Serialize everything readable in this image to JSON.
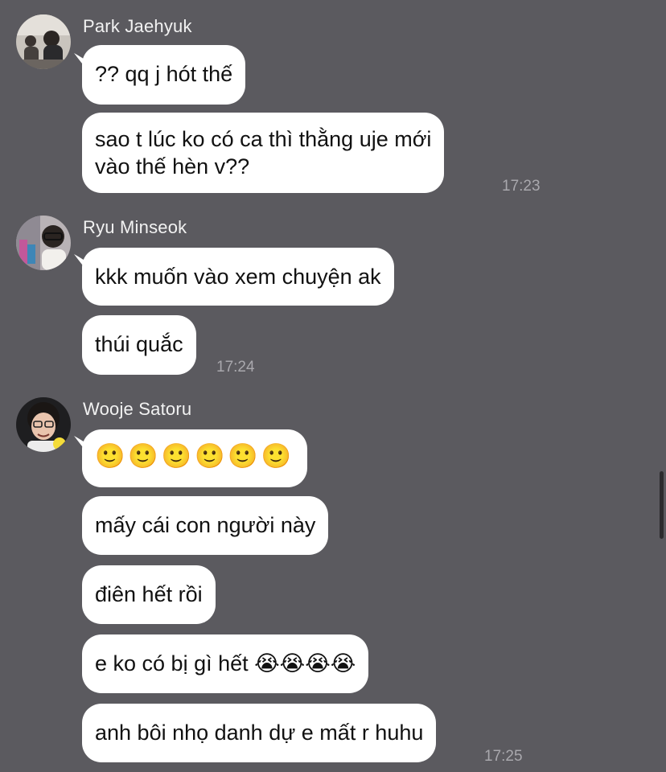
{
  "messages": [
    {
      "sender": "Park Jaehyuk",
      "bubbles": [
        "?? qq j hót thế",
        "sao t lúc ko có ca thì thằng uje mới",
        "vào thế hèn v??"
      ],
      "time": "17:23"
    },
    {
      "sender": "Ryu Minseok",
      "bubbles": [
        "kkk muốn vào xem chuyện ak",
        "thúi quắc"
      ],
      "time": "17:24"
    },
    {
      "sender": "Wooje Satoru",
      "bubbles": [
        "🙂🙂🙂🙂🙂🙂",
        "mấy cái con người này",
        "điên hết rồi",
        "e ko có bị gì hết 😭😭😭😭",
        "anh bôi nhọ danh dự e mất r huhu"
      ],
      "time": "17:25"
    }
  ],
  "colors": {
    "background": "#5b5a5f",
    "bubble": "#ffffff",
    "text": "#111111",
    "sender": "#f2f2f2",
    "timestamp": "#a9a8ad"
  }
}
